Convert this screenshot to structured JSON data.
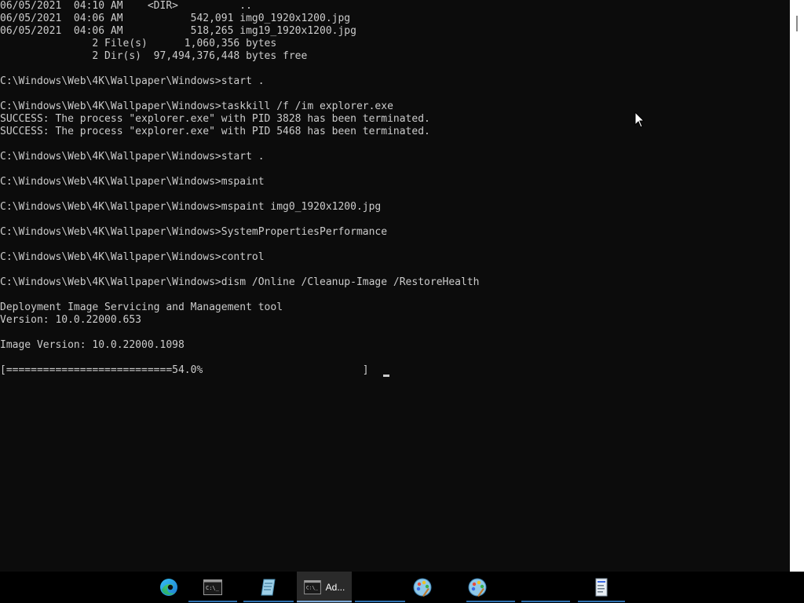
{
  "console": {
    "lines": [
      "06/05/2021  04:10 AM    <DIR>          ..",
      "06/05/2021  04:06 AM           542,091 img0_1920x1200.jpg",
      "06/05/2021  04:06 AM           518,265 img19_1920x1200.jpg",
      "               2 File(s)      1,060,356 bytes",
      "               2 Dir(s)  97,494,376,448 bytes free",
      "",
      "C:\\Windows\\Web\\4K\\Wallpaper\\Windows>start .",
      "",
      "C:\\Windows\\Web\\4K\\Wallpaper\\Windows>taskkill /f /im explorer.exe",
      "SUCCESS: The process \"explorer.exe\" with PID 3828 has been terminated.",
      "SUCCESS: The process \"explorer.exe\" with PID 5468 has been terminated.",
      "",
      "C:\\Windows\\Web\\4K\\Wallpaper\\Windows>start .",
      "",
      "C:\\Windows\\Web\\4K\\Wallpaper\\Windows>mspaint",
      "",
      "C:\\Windows\\Web\\4K\\Wallpaper\\Windows>mspaint img0_1920x1200.jpg",
      "",
      "C:\\Windows\\Web\\4K\\Wallpaper\\Windows>SystemPropertiesPerformance",
      "",
      "C:\\Windows\\Web\\4K\\Wallpaper\\Windows>control",
      "",
      "C:\\Windows\\Web\\4K\\Wallpaper\\Windows>dism /Online /Cleanup-Image /RestoreHealth",
      "",
      "Deployment Image Servicing and Management tool",
      "Version: 10.0.22000.653",
      "",
      "Image Version: 10.0.22000.1098",
      "",
      "[===========================54.0%                          ]"
    ],
    "progress_percent": 54.0
  },
  "taskbar": {
    "items": [
      {
        "name": "edge-taskbar-button",
        "icon": "edge-icon",
        "label": ""
      },
      {
        "name": "cmd-taskbar-button",
        "icon": "cmd-icon",
        "label": ""
      },
      {
        "name": "notepad-taskbar-button",
        "icon": "notepad-icon",
        "label": ""
      },
      {
        "name": "admin-cmd-taskbar-button",
        "icon": "cmd-icon",
        "label": "Ad..."
      },
      {
        "name": "paint-taskbar-button-1",
        "icon": "paint-icon",
        "label": ""
      },
      {
        "name": "paint-taskbar-button-2",
        "icon": "paint-icon",
        "label": ""
      },
      {
        "name": "system-properties-taskbar-button",
        "icon": "system-properties-icon",
        "label": ""
      }
    ]
  },
  "colors": {
    "console_bg": "#0c0c0c",
    "console_text": "#cccccc",
    "taskbar_bg": "#000000",
    "taskbar_indicator": "#2d6fae",
    "taskbar_active_bg": "#2a2a2a"
  }
}
